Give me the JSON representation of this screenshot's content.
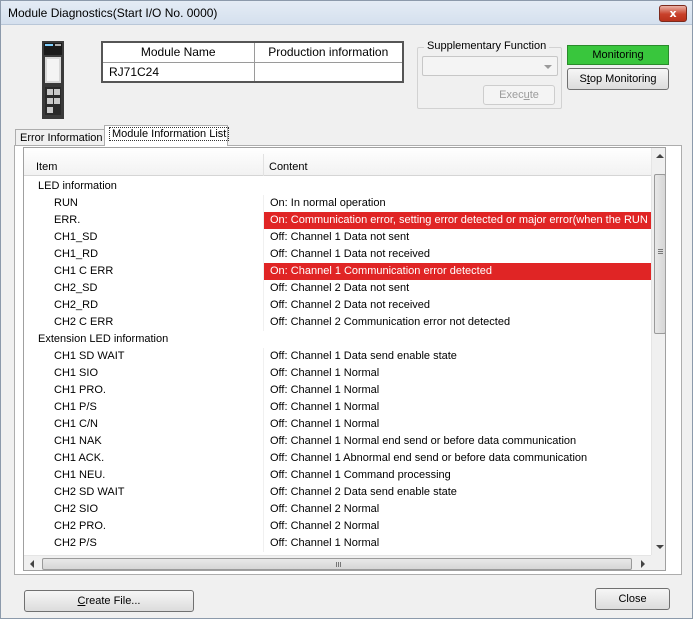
{
  "window": {
    "title": "Module Diagnostics(Start I/O No. 0000)",
    "close_glyph": "x"
  },
  "module_table": {
    "header_name": "Module Name",
    "header_production": "Production information",
    "module_name": "RJ71C24",
    "production_info": ""
  },
  "supplementary": {
    "label": "Supplementary Function",
    "selected": "",
    "execute_label": "Execute",
    "execute_mnemonic": "u"
  },
  "monitoring": {
    "status_label": "Monitoring",
    "status_color": "#39c63d",
    "stop_label_prefix": "S",
    "stop_label_mnemonic": "t",
    "stop_label_suffix": "op Monitoring"
  },
  "tabs": [
    {
      "label": "Error Information"
    },
    {
      "label": "Module Information List"
    }
  ],
  "list": {
    "col_item": "Item",
    "col_content": "Content",
    "alarm_color": "#e02525",
    "rows": [
      {
        "item": "LED information",
        "content": "",
        "sub": false,
        "alarm": false
      },
      {
        "item": "RUN",
        "content": "On: In normal operation",
        "sub": true,
        "alarm": false
      },
      {
        "item": "ERR.",
        "content": "On: Communication error, setting error detected or major error(when the RUN LED",
        "sub": true,
        "alarm": true
      },
      {
        "item": "CH1_SD",
        "content": "Off: Channel 1 Data not sent",
        "sub": true,
        "alarm": false
      },
      {
        "item": "CH1_RD",
        "content": "Off: Channel 1 Data not received",
        "sub": true,
        "alarm": false
      },
      {
        "item": "CH1 C ERR",
        "content": "On: Channel 1 Communication error detected",
        "sub": true,
        "alarm": true
      },
      {
        "item": "CH2_SD",
        "content": "Off: Channel 2 Data not sent",
        "sub": true,
        "alarm": false
      },
      {
        "item": "CH2_RD",
        "content": "Off: Channel 2 Data not received",
        "sub": true,
        "alarm": false
      },
      {
        "item": "CH2 C ERR",
        "content": "Off: Channel 2 Communication error not detected",
        "sub": true,
        "alarm": false
      },
      {
        "item": "Extension LED information",
        "content": "",
        "sub": false,
        "alarm": false
      },
      {
        "item": "CH1 SD WAIT",
        "content": "Off: Channel 1 Data send enable state",
        "sub": true,
        "alarm": false
      },
      {
        "item": "CH1 SIO",
        "content": "Off: Channel 1 Normal",
        "sub": true,
        "alarm": false
      },
      {
        "item": "CH1 PRO.",
        "content": "Off: Channel 1 Normal",
        "sub": true,
        "alarm": false
      },
      {
        "item": "CH1 P/S",
        "content": "Off: Channel 1 Normal",
        "sub": true,
        "alarm": false
      },
      {
        "item": "CH1 C/N",
        "content": "Off: Channel 1 Normal",
        "sub": true,
        "alarm": false
      },
      {
        "item": "CH1 NAK",
        "content": "Off: Channel 1 Normal end send or before data communication",
        "sub": true,
        "alarm": false
      },
      {
        "item": "CH1 ACK.",
        "content": "Off: Channel 1 Abnormal end send or before data communication",
        "sub": true,
        "alarm": false
      },
      {
        "item": "CH1 NEU.",
        "content": "Off: Channel 1 Command processing",
        "sub": true,
        "alarm": false
      },
      {
        "item": "CH2 SD WAIT",
        "content": "Off: Channel 2 Data send enable state",
        "sub": true,
        "alarm": false
      },
      {
        "item": "CH2 SIO",
        "content": "Off: Channel 2 Normal",
        "sub": true,
        "alarm": false
      },
      {
        "item": "CH2 PRO.",
        "content": "Off: Channel 2 Normal",
        "sub": true,
        "alarm": false
      },
      {
        "item": "CH2 P/S",
        "content": "Off: Channel 1 Normal",
        "sub": true,
        "alarm": false
      }
    ]
  },
  "footer": {
    "create_prefix": "",
    "create_mnemonic": "C",
    "create_suffix": "reate File...",
    "close_label": "Close"
  }
}
